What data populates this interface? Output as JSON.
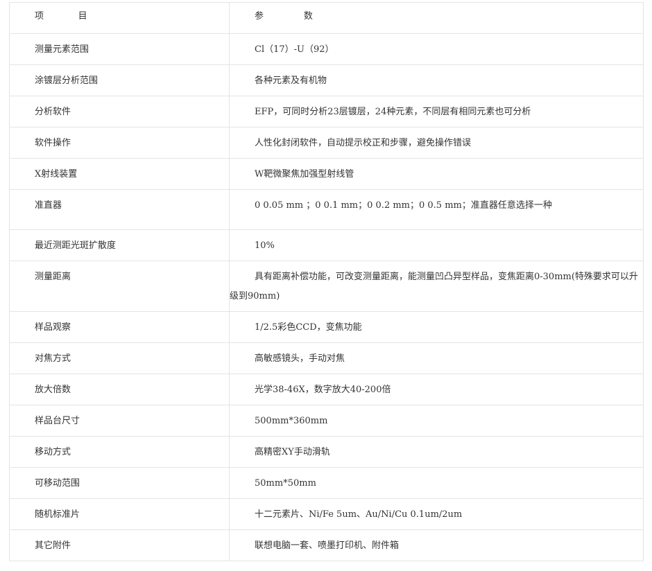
{
  "table": {
    "header": {
      "col1": "项            目",
      "col2": "参              数"
    },
    "rows": [
      {
        "label": "测量元素范围",
        "value": "Cl（17）-U（92）"
      },
      {
        "label": "涂镀层分析范围",
        "value": "各种元素及有机物"
      },
      {
        "label": "分析软件",
        "value": "EFP，可同时分析23层镀层，24种元素，不同层有相同元素也可分析"
      },
      {
        "label": "软件操作",
        "value": "人性化封闭软件，自动提示校正和步骤，避免操作错误"
      },
      {
        "label": "X射线装置",
        "value": "W靶微聚焦加强型射线管"
      },
      {
        "label": "准直器",
        "value": "0  0.05  mm   ；0  0.1  mm；0  0.2  mm；0  0.5  mm；准直器任意选择一种"
      },
      {
        "label": "最近测距光斑扩散度",
        "value": "10%"
      },
      {
        "label": "测量距离",
        "value": "具有距离补偿功能，可改变测量距离，能测量凹凸异型样品，变焦距离0-30mm(特殊要求可以升级到90mm)"
      },
      {
        "label": "样品观察",
        "value": "1/2.5彩色CCD，变焦功能"
      },
      {
        "label": "对焦方式",
        "value": "高敏感镜头，手动对焦"
      },
      {
        "label": "放大倍数",
        "value": "光学38-46X，数字放大40-200倍"
      },
      {
        "label": "样品台尺寸",
        "value": "500mm*360mm"
      },
      {
        "label": "移动方式",
        "value": "高精密XY手动滑轨"
      },
      {
        "label": "可移动范围",
        "value": "50mm*50mm"
      },
      {
        "label": "随机标准片",
        "value": "十二元素片、Ni/Fe 5um、Au/Ni/Cu 0.1um/2um"
      },
      {
        "label": "其它附件",
        "value": "联想电脑一套、喷墨打印机、附件箱"
      }
    ]
  }
}
